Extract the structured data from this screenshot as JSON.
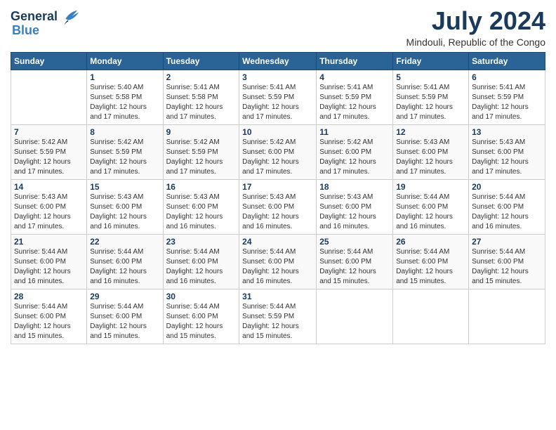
{
  "logo": {
    "line1": "General",
    "line2": "Blue"
  },
  "title": "July 2024",
  "location": "Mindouli, Republic of the Congo",
  "weekdays": [
    "Sunday",
    "Monday",
    "Tuesday",
    "Wednesday",
    "Thursday",
    "Friday",
    "Saturday"
  ],
  "weeks": [
    [
      {
        "day": "",
        "info": ""
      },
      {
        "day": "1",
        "info": "Sunrise: 5:40 AM\nSunset: 5:58 PM\nDaylight: 12 hours\nand 17 minutes."
      },
      {
        "day": "2",
        "info": "Sunrise: 5:41 AM\nSunset: 5:58 PM\nDaylight: 12 hours\nand 17 minutes."
      },
      {
        "day": "3",
        "info": "Sunrise: 5:41 AM\nSunset: 5:59 PM\nDaylight: 12 hours\nand 17 minutes."
      },
      {
        "day": "4",
        "info": "Sunrise: 5:41 AM\nSunset: 5:59 PM\nDaylight: 12 hours\nand 17 minutes."
      },
      {
        "day": "5",
        "info": "Sunrise: 5:41 AM\nSunset: 5:59 PM\nDaylight: 12 hours\nand 17 minutes."
      },
      {
        "day": "6",
        "info": "Sunrise: 5:41 AM\nSunset: 5:59 PM\nDaylight: 12 hours\nand 17 minutes."
      }
    ],
    [
      {
        "day": "7",
        "info": "Sunrise: 5:42 AM\nSunset: 5:59 PM\nDaylight: 12 hours\nand 17 minutes."
      },
      {
        "day": "8",
        "info": "Sunrise: 5:42 AM\nSunset: 5:59 PM\nDaylight: 12 hours\nand 17 minutes."
      },
      {
        "day": "9",
        "info": "Sunrise: 5:42 AM\nSunset: 5:59 PM\nDaylight: 12 hours\nand 17 minutes."
      },
      {
        "day": "10",
        "info": "Sunrise: 5:42 AM\nSunset: 6:00 PM\nDaylight: 12 hours\nand 17 minutes."
      },
      {
        "day": "11",
        "info": "Sunrise: 5:42 AM\nSunset: 6:00 PM\nDaylight: 12 hours\nand 17 minutes."
      },
      {
        "day": "12",
        "info": "Sunrise: 5:43 AM\nSunset: 6:00 PM\nDaylight: 12 hours\nand 17 minutes."
      },
      {
        "day": "13",
        "info": "Sunrise: 5:43 AM\nSunset: 6:00 PM\nDaylight: 12 hours\nand 17 minutes."
      }
    ],
    [
      {
        "day": "14",
        "info": "Sunrise: 5:43 AM\nSunset: 6:00 PM\nDaylight: 12 hours\nand 17 minutes."
      },
      {
        "day": "15",
        "info": "Sunrise: 5:43 AM\nSunset: 6:00 PM\nDaylight: 12 hours\nand 16 minutes."
      },
      {
        "day": "16",
        "info": "Sunrise: 5:43 AM\nSunset: 6:00 PM\nDaylight: 12 hours\nand 16 minutes."
      },
      {
        "day": "17",
        "info": "Sunrise: 5:43 AM\nSunset: 6:00 PM\nDaylight: 12 hours\nand 16 minutes."
      },
      {
        "day": "18",
        "info": "Sunrise: 5:43 AM\nSunset: 6:00 PM\nDaylight: 12 hours\nand 16 minutes."
      },
      {
        "day": "19",
        "info": "Sunrise: 5:44 AM\nSunset: 6:00 PM\nDaylight: 12 hours\nand 16 minutes."
      },
      {
        "day": "20",
        "info": "Sunrise: 5:44 AM\nSunset: 6:00 PM\nDaylight: 12 hours\nand 16 minutes."
      }
    ],
    [
      {
        "day": "21",
        "info": "Sunrise: 5:44 AM\nSunset: 6:00 PM\nDaylight: 12 hours\nand 16 minutes."
      },
      {
        "day": "22",
        "info": "Sunrise: 5:44 AM\nSunset: 6:00 PM\nDaylight: 12 hours\nand 16 minutes."
      },
      {
        "day": "23",
        "info": "Sunrise: 5:44 AM\nSunset: 6:00 PM\nDaylight: 12 hours\nand 16 minutes."
      },
      {
        "day": "24",
        "info": "Sunrise: 5:44 AM\nSunset: 6:00 PM\nDaylight: 12 hours\nand 16 minutes."
      },
      {
        "day": "25",
        "info": "Sunrise: 5:44 AM\nSunset: 6:00 PM\nDaylight: 12 hours\nand 15 minutes."
      },
      {
        "day": "26",
        "info": "Sunrise: 5:44 AM\nSunset: 6:00 PM\nDaylight: 12 hours\nand 15 minutes."
      },
      {
        "day": "27",
        "info": "Sunrise: 5:44 AM\nSunset: 6:00 PM\nDaylight: 12 hours\nand 15 minutes."
      }
    ],
    [
      {
        "day": "28",
        "info": "Sunrise: 5:44 AM\nSunset: 6:00 PM\nDaylight: 12 hours\nand 15 minutes."
      },
      {
        "day": "29",
        "info": "Sunrise: 5:44 AM\nSunset: 6:00 PM\nDaylight: 12 hours\nand 15 minutes."
      },
      {
        "day": "30",
        "info": "Sunrise: 5:44 AM\nSunset: 6:00 PM\nDaylight: 12 hours\nand 15 minutes."
      },
      {
        "day": "31",
        "info": "Sunrise: 5:44 AM\nSunset: 5:59 PM\nDaylight: 12 hours\nand 15 minutes."
      },
      {
        "day": "",
        "info": ""
      },
      {
        "day": "",
        "info": ""
      },
      {
        "day": "",
        "info": ""
      }
    ]
  ]
}
